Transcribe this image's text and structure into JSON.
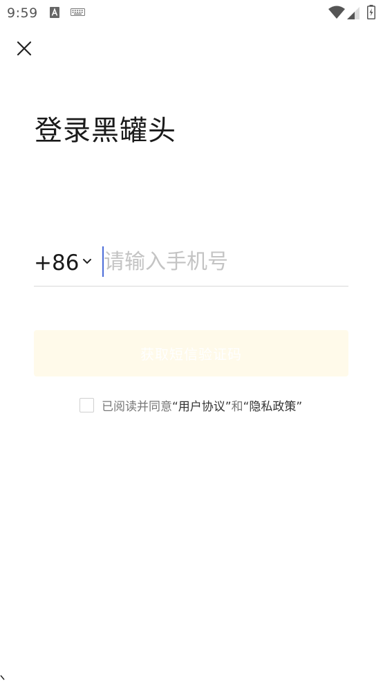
{
  "status_bar": {
    "time": "9:59",
    "icons": [
      "app-a-icon",
      "keyboard-icon",
      "wifi-icon",
      "signal-icon",
      "battery-icon"
    ]
  },
  "header": {
    "close_icon": "close-icon",
    "title": "登录黑罐头"
  },
  "phone": {
    "country_code": "+86",
    "value": "",
    "placeholder": "请输入手机号"
  },
  "sms_button": {
    "label": "获取短信验证码",
    "enabled": false
  },
  "agreement": {
    "checked": false,
    "prefix": "已阅读并同意",
    "terms_link": "“用户协议”",
    "conjunction": "和",
    "privacy_link": "“隐私政策”"
  },
  "colors": {
    "accent_cursor": "#4a6bd8",
    "button_disabled_bg": "#fffaea",
    "placeholder": "#c4c4c4",
    "divider": "#d9d9d9"
  }
}
